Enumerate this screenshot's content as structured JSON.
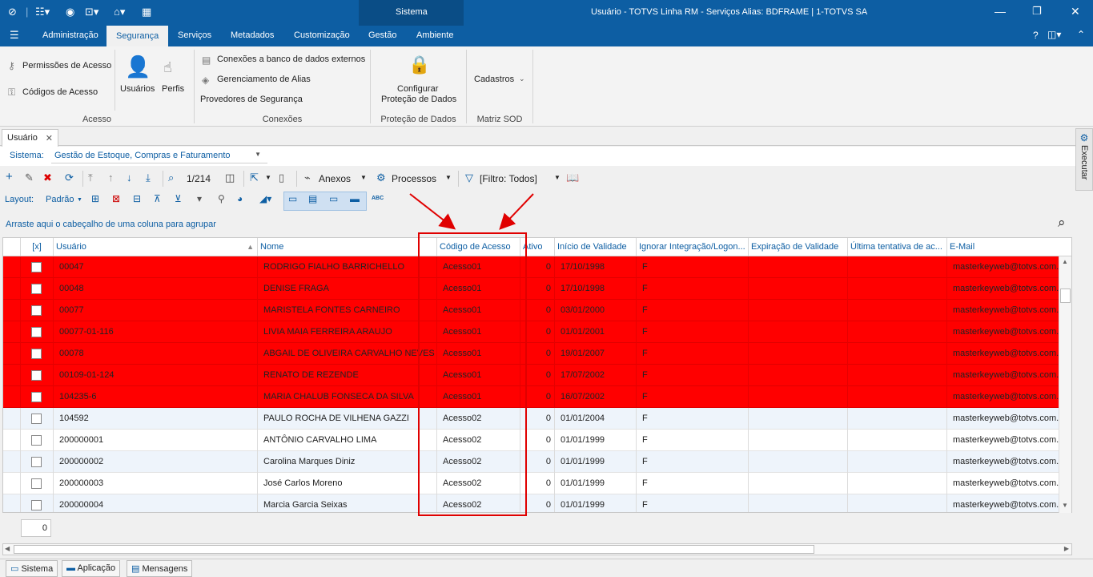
{
  "titlebar": {
    "context_tab": "Sistema",
    "title": "Usuário - TOTVS Linha RM - Serviços  Alias: BDFRAME | 1-TOTVS SA"
  },
  "menu": [
    "Administração",
    "Segurança",
    "Serviços",
    "Metadados",
    "Customização",
    "Gestão",
    "Ambiente"
  ],
  "ribbon": {
    "acesso": {
      "items": [
        "Permissões de Acesso",
        "Códigos de Acesso",
        "Usuários",
        "Perfis"
      ],
      "label": "Acesso"
    },
    "conexoes": {
      "items": [
        "Conexões a banco de dados externos",
        "Gerenciamento de Alias",
        "Provedores de Segurança"
      ],
      "label": "Conexões"
    },
    "protecao": {
      "line1": "Configurar",
      "line2": "Proteção de Dados",
      "label": "Proteção de Dados"
    },
    "matriz": {
      "item": "Cadastros",
      "label": "Matriz SOD"
    }
  },
  "doc_tab": "Usuário",
  "side_panel": "Executar",
  "sistema": {
    "label": "Sistema:",
    "value": "Gestão de Estoque, Compras e Faturamento"
  },
  "toolbar": {
    "record": "1/214",
    "anexos": "Anexos",
    "processos": "Processos",
    "filtro": "[Filtro: Todos]"
  },
  "layout": {
    "label": "Layout:",
    "value": "Padrão"
  },
  "group_hint": "Arraste aqui o cabeçalho de uma coluna para agrupar",
  "grid": {
    "columns": [
      "[x]",
      "Usuário",
      "Nome",
      "Código de Acesso",
      "Ativo",
      "Início de Validade",
      "Ignorar Integração/Logon...",
      "Expiração de Validade",
      "Última tentativa de ac...",
      "E-Mail"
    ],
    "rows": [
      {
        "red": true,
        "usuario": "00047",
        "nome": "RODRIGO FIALHO BARRICHELLO",
        "codigo": "Acesso01",
        "ativo": "0",
        "inicio": "17/10/1998",
        "ignorar": "F",
        "email": "masterkeyweb@totvs.com.b"
      },
      {
        "red": true,
        "usuario": "00048",
        "nome": "DENISE FRAGA",
        "codigo": "Acesso01",
        "ativo": "0",
        "inicio": "17/10/1998",
        "ignorar": "F",
        "email": "masterkeyweb@totvs.com.b"
      },
      {
        "red": true,
        "usuario": "00077",
        "nome": "MARISTELA FONTES CARNEIRO",
        "codigo": "Acesso01",
        "ativo": "0",
        "inicio": "03/01/2000",
        "ignorar": "F",
        "email": "masterkeyweb@totvs.com.b"
      },
      {
        "red": true,
        "usuario": "00077-01-116",
        "nome": "LIVIA MAIA FERREIRA ARAUJO",
        "codigo": "Acesso01",
        "ativo": "0",
        "inicio": "01/01/2001",
        "ignorar": "F",
        "email": "masterkeyweb@totvs.com.b"
      },
      {
        "red": true,
        "usuario": "00078",
        "nome": "ABGAIL DE OLIVEIRA CARVALHO NEVES",
        "codigo": "Acesso01",
        "ativo": "0",
        "inicio": "19/01/2007",
        "ignorar": "F",
        "email": "masterkeyweb@totvs.com.b"
      },
      {
        "red": true,
        "usuario": "00109-01-124",
        "nome": "RENATO DE REZENDE",
        "codigo": "Acesso01",
        "ativo": "0",
        "inicio": "17/07/2002",
        "ignorar": "F",
        "email": "masterkeyweb@totvs.com.b"
      },
      {
        "red": true,
        "usuario": "104235-6",
        "nome": "MARIA CHALUB FONSECA DA SILVA",
        "codigo": "Acesso01",
        "ativo": "0",
        "inicio": "16/07/2002",
        "ignorar": "F",
        "email": "masterkeyweb@totvs.com.b"
      },
      {
        "red": false,
        "usuario": "104592",
        "nome": "PAULO ROCHA DE VILHENA GAZZI",
        "codigo": "Acesso02",
        "ativo": "0",
        "inicio": "01/01/2004",
        "ignorar": "F",
        "email": "masterkeyweb@totvs.com.b"
      },
      {
        "red": false,
        "usuario": "200000001",
        "nome": "ANTÔNIO CARVALHO LIMA",
        "codigo": "Acesso02",
        "ativo": "0",
        "inicio": "01/01/1999",
        "ignorar": "F",
        "email": "masterkeyweb@totvs.com.b"
      },
      {
        "red": false,
        "usuario": "200000002",
        "nome": "Carolina Marques Diniz",
        "codigo": "Acesso02",
        "ativo": "0",
        "inicio": "01/01/1999",
        "ignorar": "F",
        "email": "masterkeyweb@totvs.com.b"
      },
      {
        "red": false,
        "usuario": "200000003",
        "nome": "José Carlos Moreno",
        "codigo": "Acesso02",
        "ativo": "0",
        "inicio": "01/01/1999",
        "ignorar": "F",
        "email": "masterkeyweb@totvs.com.b"
      },
      {
        "red": false,
        "usuario": "200000004",
        "nome": "Marcia Garcia Seixas",
        "codigo": "Acesso02",
        "ativo": "0",
        "inicio": "01/01/1999",
        "ignorar": "F",
        "email": "masterkeyweb@totvs.com.b"
      }
    ]
  },
  "footer_count": "0",
  "status": [
    "Sistema",
    "Aplicação",
    "Mensagens"
  ],
  "colors": {
    "accent": "#0d5ea3",
    "highlight_row": "#ff0000"
  }
}
